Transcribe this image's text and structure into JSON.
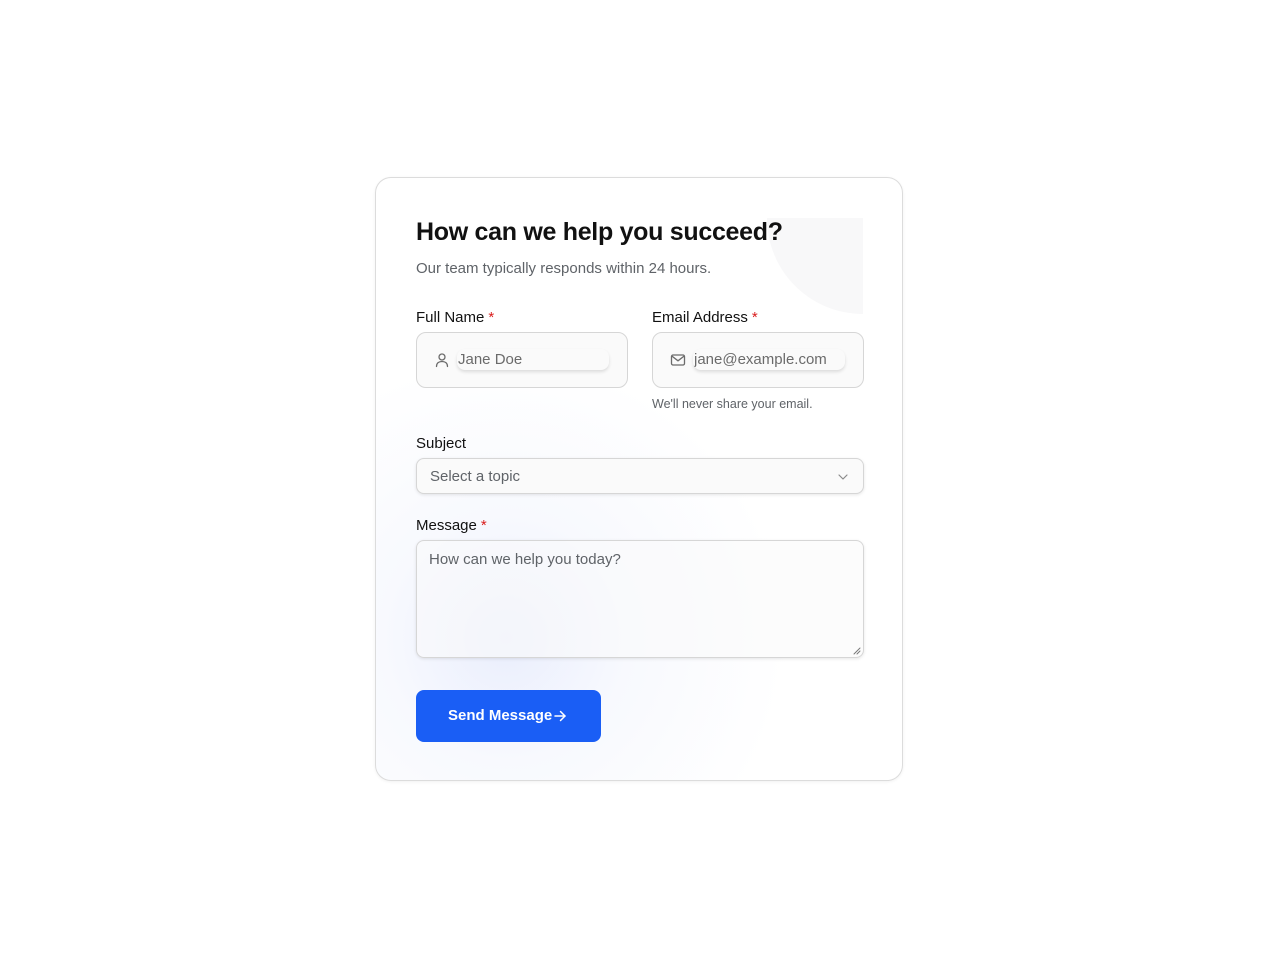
{
  "form": {
    "title": "How can we help you succeed?",
    "subtitle": "Our team typically responds within 24 hours.",
    "required_marker": "*",
    "full_name": {
      "label": "Full Name",
      "placeholder": "Jane Doe",
      "icon": "user-icon"
    },
    "email": {
      "label": "Email Address",
      "placeholder": "jane@example.com",
      "helper": "We'll never share your email.",
      "icon": "mail-icon"
    },
    "subject": {
      "label": "Subject",
      "selected": "Select a topic",
      "icon": "chevron-down-icon"
    },
    "message": {
      "label": "Message",
      "placeholder": "How can we help you today?"
    },
    "submit": {
      "label": "Send Message",
      "icon": "arrow-right-icon"
    }
  },
  "colors": {
    "accent": "#1a5ef5",
    "required": "#d91c1c",
    "muted_text": "#5f6368",
    "border": "#d6d6d6"
  }
}
